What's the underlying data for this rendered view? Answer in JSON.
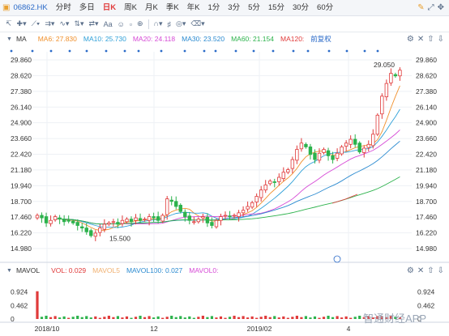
{
  "tabbar": {
    "symbol": "06862.HK",
    "periods": [
      "分时",
      "多日",
      "日K",
      "周K",
      "月K",
      "季K",
      "年K",
      "1分",
      "3分",
      "5分",
      "15分",
      "30分",
      "60分"
    ],
    "active_period": "日K"
  },
  "toolbar": {
    "aa_label": "Aa"
  },
  "ma_bar": {
    "label": "MA",
    "items": [
      {
        "text": "MA6: 27.830",
        "color": "#f0902c"
      },
      {
        "text": "MA10: 25.730",
        "color": "#2fa0d8"
      },
      {
        "text": "MA20: 24.118",
        "color": "#d64ad6"
      },
      {
        "text": "MA30: 23.520",
        "color": "#2a8ad0"
      },
      {
        "text": "MA60: 21.154",
        "color": "#2cb24c"
      },
      {
        "text": "MA120:",
        "color": "#e03a3a"
      }
    ],
    "fq_label": "前复权"
  },
  "vol_bar": {
    "label": "MAVOL",
    "items": [
      {
        "text": "VOL: 0.029",
        "color": "#e03a3a"
      },
      {
        "text": "MAVOL5",
        "color": "#f0b070"
      },
      {
        "text": "MAVOL100: 0.027",
        "color": "#2a8ad0"
      },
      {
        "text": "MAVOL0:",
        "color": "#d64ad6"
      }
    ]
  },
  "price_axis": {
    "ticks": [
      "29.860",
      "28.620",
      "27.380",
      "26.140",
      "24.900",
      "23.660",
      "22.420",
      "21.180",
      "19.940",
      "18.700",
      "17.460",
      "16.220",
      "14.980"
    ]
  },
  "volume_axis": {
    "ticks": [
      "0.924",
      "0.462",
      "0"
    ]
  },
  "date_axis": {
    "ticks": [
      "2018/10",
      "12",
      "2019/02",
      "4"
    ]
  },
  "annotations": {
    "high": "29.050",
    "low": "15.500"
  },
  "watermark": "智通财经APP",
  "colors": {
    "up": "#e03a3a",
    "down": "#2cb24c",
    "accent": "#2a6ac8"
  },
  "chart_data": {
    "type": "candlestick",
    "y_range": [
      14.98,
      29.86
    ],
    "volume_range": [
      0,
      1.386
    ],
    "price_series": [
      17.6,
      17.4,
      17.0,
      17.2,
      17.5,
      17.3,
      17.1,
      17.2,
      17.0,
      16.8,
      16.6,
      16.3,
      16.0,
      16.2,
      16.6,
      16.9,
      17.0,
      17.1,
      16.9,
      17.2,
      17.3,
      17.1,
      17.4,
      17.2,
      17.3,
      17.5,
      17.4,
      17.2,
      17.6,
      18.9,
      18.7,
      18.3,
      17.9,
      17.5,
      17.2,
      17.1,
      17.3,
      17.5,
      17.0,
      16.8,
      17.2,
      17.5,
      17.6,
      17.5,
      17.6,
      17.8,
      18.0,
      18.3,
      18.6,
      19.1,
      19.6,
      20.0,
      20.3,
      20.2,
      20.6,
      21.0,
      21.2,
      22.0,
      22.8,
      23.3,
      23.0,
      22.4,
      22.0,
      22.5,
      22.8,
      22.3,
      22.0,
      22.5,
      23.0,
      23.3,
      23.6,
      23.2,
      22.6,
      22.9,
      23.2,
      24.0,
      25.5,
      27.0,
      28.0,
      28.8,
      28.6,
      29.05
    ]
  }
}
